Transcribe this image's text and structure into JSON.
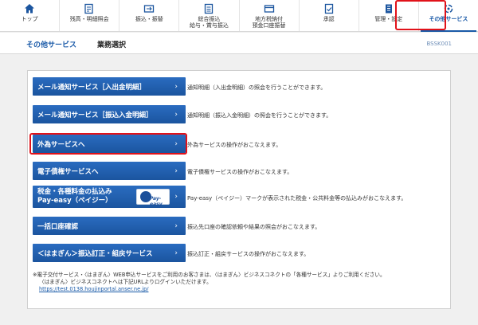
{
  "nav": {
    "items": [
      {
        "label": "トップ",
        "icon": "home-icon"
      },
      {
        "label": "残高・明細照会",
        "icon": "balance-icon"
      },
      {
        "label": "振込・振替",
        "icon": "transfer-icon"
      },
      {
        "label": "総合振込\n給与・賞与振込",
        "icon": "bulk-transfer-icon"
      },
      {
        "label": "地方税納付\n預金口座振替",
        "icon": "tax-icon"
      },
      {
        "label": "承認",
        "icon": "approval-icon"
      },
      {
        "label": "管理・設定",
        "icon": "settings-icon"
      },
      {
        "label": "その他サービス",
        "icon": "other-services-icon"
      }
    ],
    "active_index": 7
  },
  "title": {
    "main": "その他サービス",
    "sub": "業務選択",
    "screen_id": "BSSK001"
  },
  "menu": [
    {
      "label": "メール通知サービス［入出金明細］",
      "arrow": "›",
      "desc": "通知明細（入出金明細）の照会を行うことができます。"
    },
    {
      "label": "メール通知サービス［振込入金明細］",
      "arrow": "›",
      "desc": "通知明細（振込入金明細）の照会を行うことができます。"
    },
    {
      "label": "外為サービスへ",
      "arrow": "›",
      "desc": "外為サービスの操作がおこなえます。"
    },
    {
      "label": "電子債権サービスへ",
      "arrow": "›",
      "desc": "電子債権サービスの操作がおこなえます。"
    },
    {
      "label_line1": "税金・各種料金の払込み",
      "label_line2": "Pay-easy（ペイジー）",
      "arrow": "›",
      "badge": "Pay-easy",
      "desc": "Pay-easy（ペイジー）マークが表示された税金・公共料金等の払込みがおこなえます。"
    },
    {
      "label": "一括口座確認",
      "arrow": "›",
      "desc": "振込先口座の確認依頼や結果の照会がおこなえます。"
    },
    {
      "label": "＜はまぎん＞振込訂正・組戻サービス",
      "arrow": "›",
      "desc": "振込訂正・組戻サービスの操作がおこなえます。"
    }
  ],
  "note": {
    "line1": "※電子交付サービス・〈はまぎん〉WEB申込サービスをご利用のお客さまは、〈はまぎん〉ビジネスコネクトの「各種サービス」よりご利用ください。",
    "line2": "〈はまぎん〉ビジネスコネクトへは下記URLよりログインいただけます。",
    "url": "https://test.0138.houjinportal.anser.ne.jp/"
  },
  "colors": {
    "primary": "#1b559f",
    "highlight": "#e1121a",
    "link": "#1a5aa8"
  }
}
